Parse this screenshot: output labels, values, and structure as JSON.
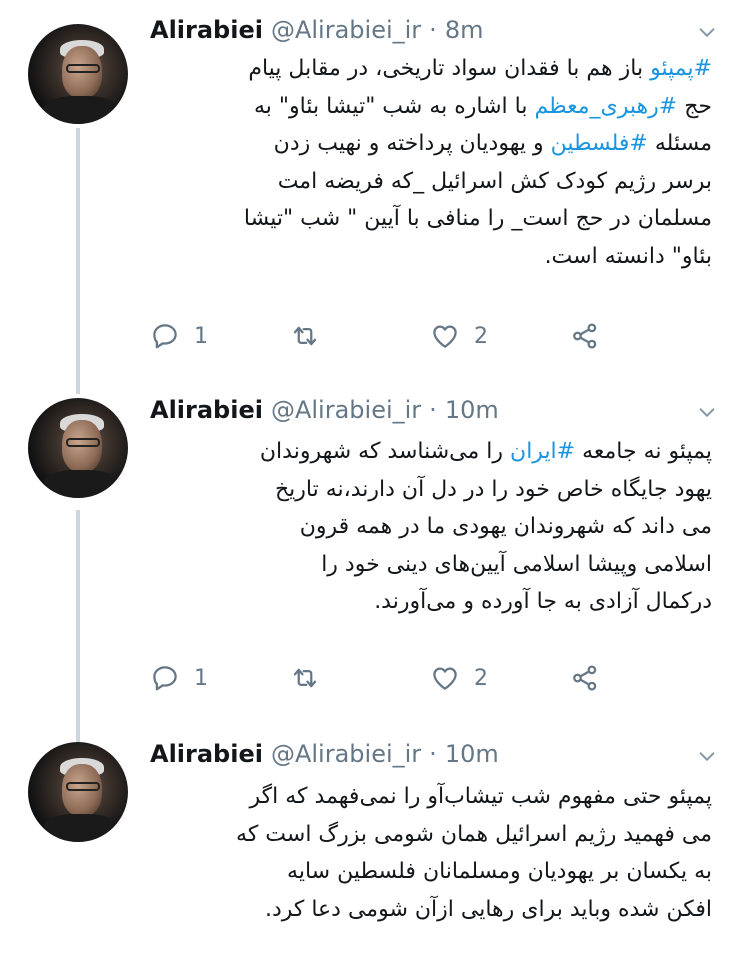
{
  "tweets": [
    {
      "author_name": "Alirabiei",
      "handle": "@Alirabiei_ir",
      "separator": "·",
      "time": "8m",
      "body_lines": [
        [
          {
            "t": "#پمپئو",
            "h": true
          },
          {
            "t": " باز هم با فقدان سواد تاریخی، در مقابل پیام"
          }
        ],
        [
          {
            "t": "حج "
          },
          {
            "t": "#رهبری_معظم",
            "h": true
          },
          {
            "t": " با اشاره به شب \"تیشا بئاو\" به"
          }
        ],
        [
          {
            "t": "مسئله "
          },
          {
            "t": "#فلسطین",
            "h": true
          },
          {
            "t": " و یهودیان پرداخته و نهیب زدن"
          }
        ],
        [
          {
            "t": "برسر رژیم کودک کش اسرائیل _که فریضه امت"
          }
        ],
        [
          {
            "t": "مسلمان در حج است_ را منافی با آیین \" شب \"تیشا"
          }
        ],
        [
          {
            "t": "بئاو\" دانسته است."
          }
        ]
      ],
      "reply_count": "1",
      "retweet_count": "",
      "like_count": "2"
    },
    {
      "author_name": "Alirabiei",
      "handle": "@Alirabiei_ir",
      "separator": "·",
      "time": "10m",
      "body_lines": [
        [
          {
            "t": "پمپئو نه جامعه "
          },
          {
            "t": "#ایران",
            "h": true
          },
          {
            "t": " را می‌شناسد که شهروندان"
          }
        ],
        [
          {
            "t": "یهود جایگاه خاص خود را در دل آن دارند،نه تاریخ"
          }
        ],
        [
          {
            "t": "می داند که شهروندان یهودی ما در همه قرون"
          }
        ],
        [
          {
            "t": "اسلامی وپیشا اسلامی آیین‌های دینی خود را"
          }
        ],
        [
          {
            "t": "درکمال آزادی به جا آورده و می‌آورند."
          }
        ]
      ],
      "reply_count": "1",
      "retweet_count": "",
      "like_count": "2"
    },
    {
      "author_name": "Alirabiei",
      "handle": "@Alirabiei_ir",
      "separator": "·",
      "time": "10m",
      "body_lines": [
        [
          {
            "t": "پمپئو حتی مفهوم شب تیشاب‌آو را نمی‌فهمد که اگر"
          }
        ],
        [
          {
            "t": "می فهمید رژیم اسرائیل همان شومی بزرگ است که"
          }
        ],
        [
          {
            "t": "به یکسان بر یهودیان ومسلمانان فلسطین سایه"
          }
        ],
        [
          {
            "t": "افکن شده وباید برای رهایی ازآن شومی دعا کرد."
          }
        ]
      ]
    }
  ],
  "icons": {
    "reply": "reply-icon",
    "retweet": "retweet-icon",
    "like": "heart-icon",
    "share": "share-icon",
    "menu": "chevron-down-icon"
  },
  "colors": {
    "hashtag": "#1b95e0",
    "secondary": "#657786",
    "thread_line": "#ccd6dd"
  }
}
